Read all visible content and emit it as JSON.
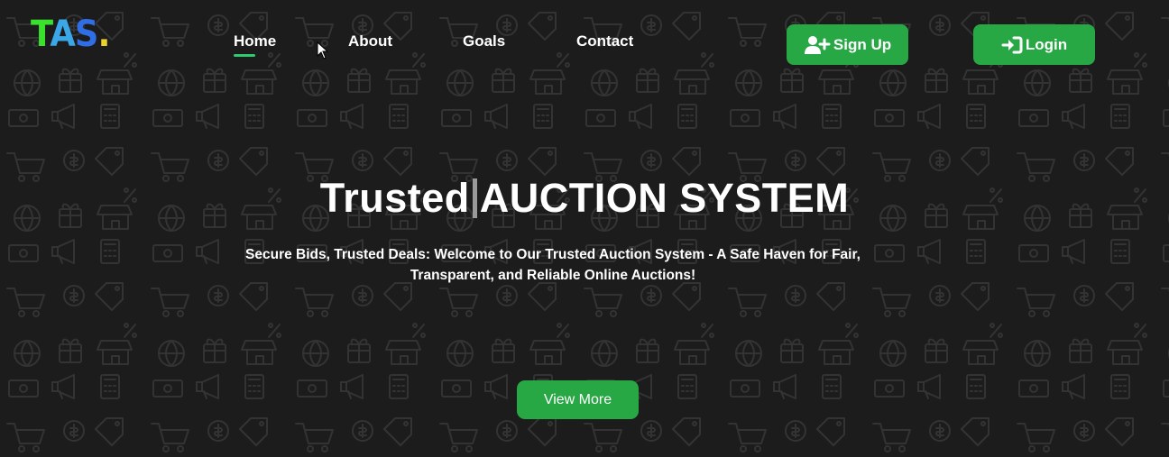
{
  "brand": {
    "logo_letter_t": "T",
    "logo_letter_a": "A",
    "logo_letter_s": "S",
    "logo_dot": "."
  },
  "nav": {
    "items": [
      {
        "label": "Home",
        "active": true
      },
      {
        "label": "About",
        "active": false
      },
      {
        "label": "Goals",
        "active": false
      },
      {
        "label": "Contact",
        "active": false
      }
    ]
  },
  "header_buttons": {
    "signup_label": "Sign Up",
    "signup_icon": "user-plus-icon",
    "login_label": "Login",
    "login_icon": "sign-in-icon"
  },
  "hero": {
    "title_part1": "Trusted",
    "title_part2": "AUCTION SYSTEM",
    "subtitle": "Secure Bids, Trusted Deals: Welcome to Our Trusted Auction System - A Safe Haven for Fair, Transparent, and Reliable Online Auctions!",
    "cta_label": "View More"
  },
  "colors": {
    "background": "#1c1c1c",
    "accent_green": "#28a745",
    "nav_underline": "#2ecc71",
    "logo_t": "#39e12d",
    "logo_a": "#3aa8e8",
    "logo_s": "#2f6ee5",
    "logo_dot": "#e9d22b"
  }
}
